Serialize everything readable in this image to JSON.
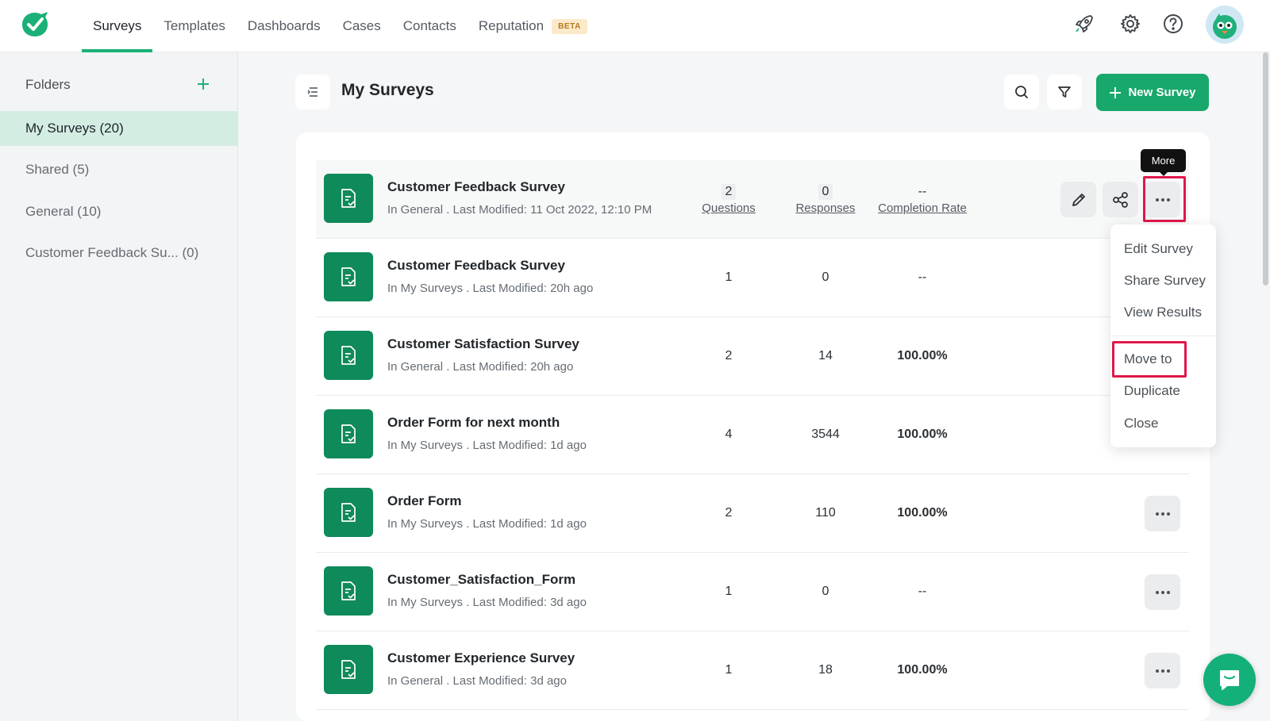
{
  "nav": {
    "items": [
      {
        "label": "Surveys",
        "active": true
      },
      {
        "label": "Templates"
      },
      {
        "label": "Dashboards"
      },
      {
        "label": "Cases"
      },
      {
        "label": "Contacts"
      },
      {
        "label": "Reputation",
        "badge": "BETA"
      }
    ],
    "icons": [
      "rocket-icon",
      "gear-icon",
      "help-icon"
    ]
  },
  "sidebar": {
    "header": "Folders",
    "folders": [
      {
        "label": "My Surveys (20)",
        "active": true
      },
      {
        "label": "Shared (5)"
      },
      {
        "label": "General (10)"
      },
      {
        "label": "Customer Feedback Su... (0)"
      }
    ]
  },
  "main": {
    "title": "My Surveys",
    "new_button": "New Survey",
    "accent": "#18a86b"
  },
  "surveys": [
    {
      "name": "Customer Feedback Survey",
      "meta": "In General . Last Modified: 11 Oct 2022, 12:10 PM",
      "questions": "2",
      "responses": "0",
      "completion": "--"
    },
    {
      "name": "Customer Feedback Survey",
      "meta": "In My Surveys . Last Modified: 20h ago",
      "questions": "1",
      "responses": "0",
      "completion": "--"
    },
    {
      "name": "Customer Satisfaction Survey",
      "meta": "In General . Last Modified: 20h ago",
      "questions": "2",
      "responses": "14",
      "completion": "100.00%"
    },
    {
      "name": "Order Form for next month",
      "meta": "In My Surveys . Last Modified: 1d ago",
      "questions": "4",
      "responses": "3544",
      "completion": "100.00%"
    },
    {
      "name": "Order Form",
      "meta": "In My Surveys . Last Modified: 1d ago",
      "questions": "2",
      "responses": "110",
      "completion": "100.00%"
    },
    {
      "name": "Customer_Satisfaction_Form",
      "meta": "In My Surveys . Last Modified: 3d ago",
      "questions": "1",
      "responses": "0",
      "completion": "--"
    },
    {
      "name": "Customer Experience Survey",
      "meta": "In General . Last Modified: 3d ago",
      "questions": "1",
      "responses": "18",
      "completion": "100.00%"
    }
  ],
  "stat_labels": {
    "questions": "Questions",
    "responses": "Responses",
    "completion": "Completion Rate"
  },
  "tooltip": "More",
  "dropdown": [
    "Edit Survey",
    "Share Survey",
    "View Results",
    "Move to",
    "Duplicate",
    "Close"
  ],
  "highlight_color": "#e0174b"
}
